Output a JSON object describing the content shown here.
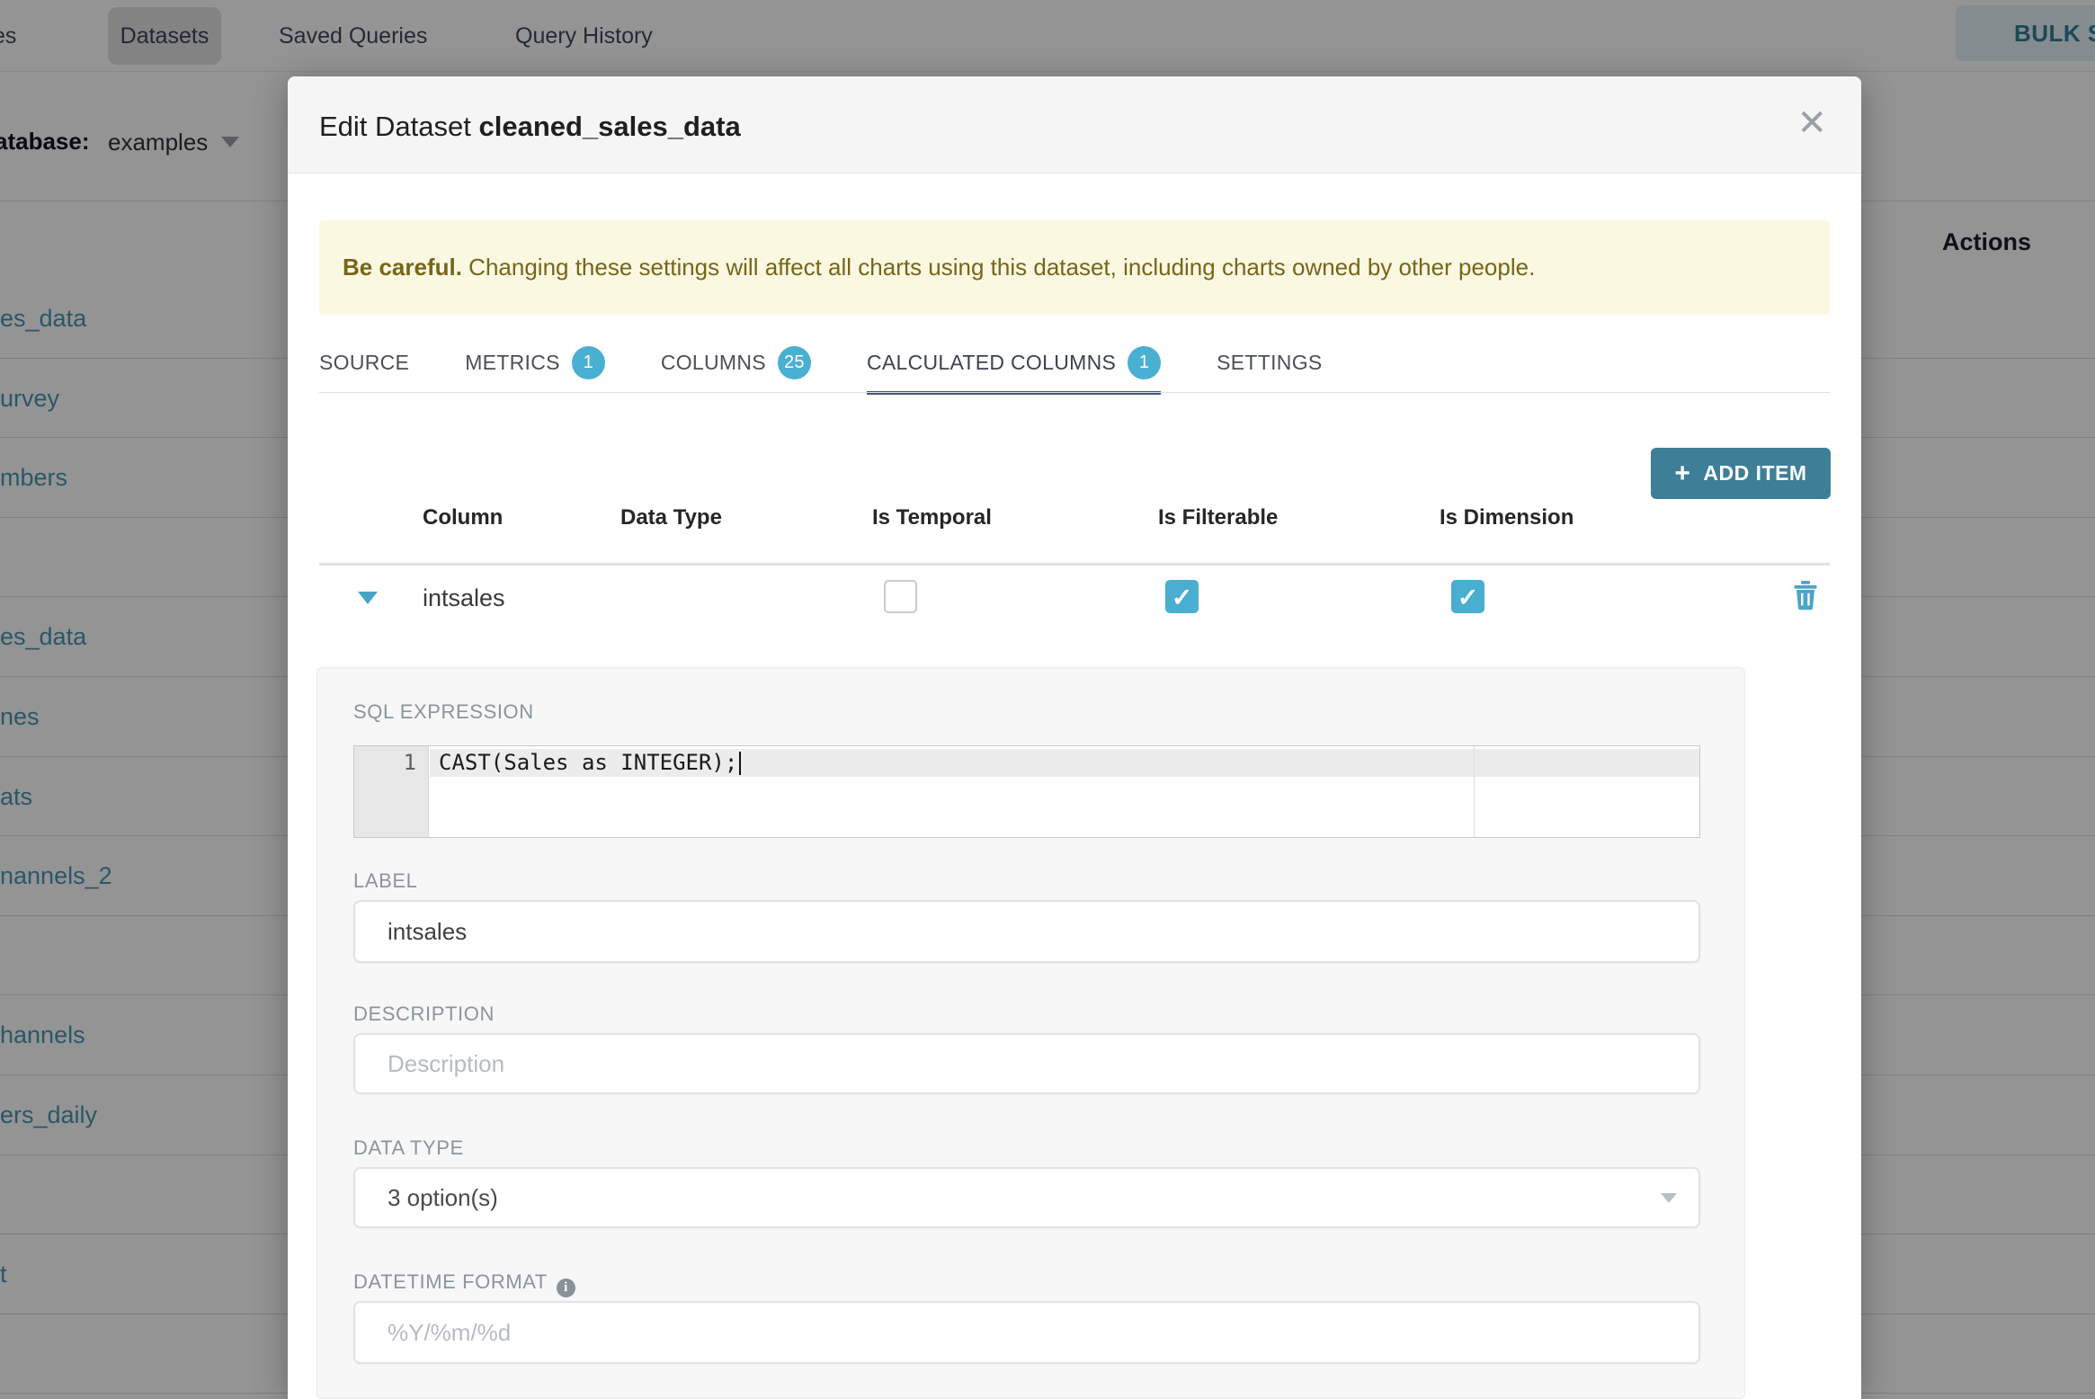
{
  "background": {
    "nav": {
      "clipped_tab_fragment": "es",
      "datasets_tab": "Datasets",
      "saved_queries_tab": "Saved Queries",
      "query_history_tab": "Query History",
      "bulk_select_button": "BULK SELECT"
    },
    "filter": {
      "database_label_fragment": "atabase:",
      "database_value": "examples"
    },
    "table": {
      "actions_header": "Actions",
      "row_fragments": [
        "es_data",
        "urvey",
        "mbers",
        "",
        "es_data",
        "nes",
        "ats",
        "nannels_2",
        "",
        "hannels",
        "ers_daily",
        "",
        "t",
        ""
      ]
    }
  },
  "modal": {
    "title_prefix": "Edit Dataset ",
    "title_name": "cleaned_sales_data",
    "close_glyph": "✕",
    "warning": {
      "bold": "Be careful.",
      "text": " Changing these settings will affect all charts using this dataset, including charts owned by other people."
    },
    "tabs": [
      {
        "label": "SOURCE"
      },
      {
        "label": "METRICS",
        "badge": "1"
      },
      {
        "label": "COLUMNS",
        "badge": "25"
      },
      {
        "label": "CALCULATED COLUMNS",
        "badge": "1",
        "active": true
      },
      {
        "label": "SETTINGS"
      }
    ],
    "add_item_label": "ADD ITEM",
    "add_item_plus": "+",
    "columns_table": {
      "headers": [
        "Column",
        "Data Type",
        "Is Temporal",
        "Is Filterable",
        "Is Dimension"
      ],
      "row": {
        "column": "intsales",
        "is_temporal": false,
        "is_filterable": true,
        "is_dimension": true,
        "check_glyph": "✓"
      }
    },
    "detail": {
      "sql_label": "SQL EXPRESSION",
      "sql_line_number": "1",
      "sql_code": "CAST(Sales as INTEGER);",
      "label_label": "LABEL",
      "label_value": "intsales",
      "description_label": "DESCRIPTION",
      "description_placeholder": "Description",
      "datatype_label": "DATA TYPE",
      "datatype_value": "3 option(s)",
      "datetime_label": "DATETIME FORMAT",
      "datetime_info": "i",
      "datetime_placeholder": "%Y/%m/%d"
    }
  },
  "colors": {
    "accent_checkbox": "#4aaed0",
    "badge": "#4ab0d2",
    "primary_button": "#3e7f98",
    "active_tab_underline": "#475677",
    "warning_bg": "#fbf8e2",
    "warning_text": "#776518",
    "link_teal": "#4796b4"
  }
}
